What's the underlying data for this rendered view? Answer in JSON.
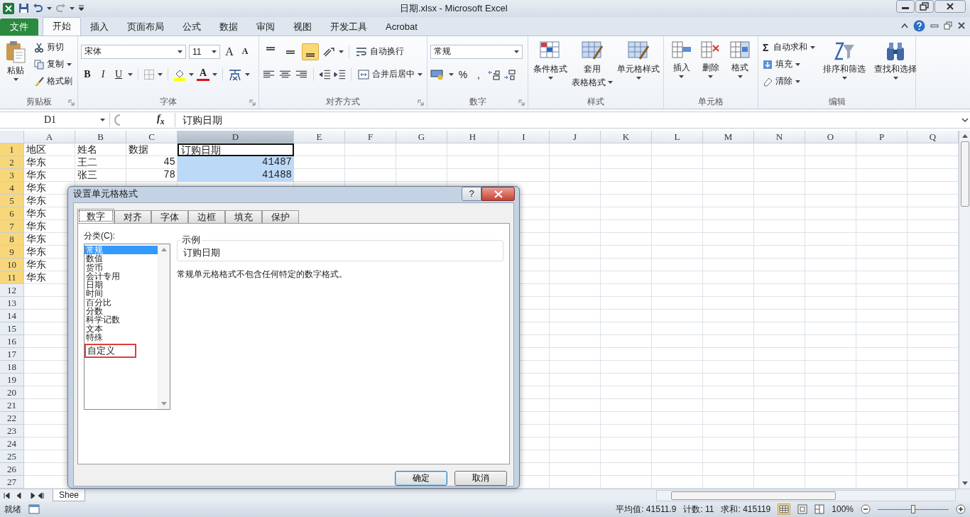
{
  "window": {
    "title": "日期.xlsx - Microsoft Excel"
  },
  "ribbon": {
    "tabs": [
      {
        "label": "文件",
        "kind": "file",
        "selected": false
      },
      {
        "label": "开始",
        "kind": "tab",
        "selected": true
      },
      {
        "label": "插入",
        "kind": "tab",
        "selected": false
      },
      {
        "label": "页面布局",
        "kind": "tab",
        "selected": false
      },
      {
        "label": "公式",
        "kind": "tab",
        "selected": false
      },
      {
        "label": "数据",
        "kind": "tab",
        "selected": false
      },
      {
        "label": "审阅",
        "kind": "tab",
        "selected": false
      },
      {
        "label": "视图",
        "kind": "tab",
        "selected": false
      },
      {
        "label": "开发工具",
        "kind": "tab",
        "selected": false
      },
      {
        "label": "Acrobat",
        "kind": "tab",
        "selected": false
      }
    ],
    "clipboard": {
      "title": "剪贴板",
      "paste": "粘贴",
      "cut": "剪切",
      "copy": "复制",
      "format_painter": "格式刷"
    },
    "font": {
      "title": "字体",
      "font_name": "宋体",
      "font_size": "11",
      "grow": "A",
      "shrink": "A",
      "bold": "B",
      "italic": "I",
      "underline": "U",
      "font_color": "A"
    },
    "alignment": {
      "title": "对齐方式",
      "vertical_align": [
        {
          "selected": false
        },
        {
          "selected": false
        },
        {
          "selected": true
        }
      ],
      "wrap": "自动换行",
      "merge": "合并后居中"
    },
    "number": {
      "title": "数字",
      "format": "常规",
      "percent": "%",
      "comma": ","
    },
    "styles": {
      "title": "样式",
      "buttons": [
        {
          "label": "条件格式",
          "kind": "conditional"
        },
        {
          "label": "套用",
          "label2": "表格格式",
          "kind": "table"
        },
        {
          "label": "单元格样式",
          "kind": "cellstyle"
        }
      ]
    },
    "cells": {
      "title": "单元格",
      "buttons": [
        {
          "label": "插入",
          "kind": "insert"
        },
        {
          "label": "删除",
          "kind": "delete"
        },
        {
          "label": "格式",
          "kind": "format"
        }
      ]
    },
    "editing": {
      "title": "编辑",
      "sigma": "Σ",
      "autosum": "自动求和",
      "fill": "填充",
      "clear": "清除",
      "sort": "排序和筛选",
      "find": "查找和选择"
    }
  },
  "formula_bar": {
    "name_box": "D1",
    "fx": "f$_{x}$",
    "content": "订购日期"
  },
  "sheet": {
    "columns": [
      {
        "label": "A",
        "selected": false
      },
      {
        "label": "B",
        "selected": false
      },
      {
        "label": "C",
        "selected": false
      },
      {
        "label": "D",
        "selected": true
      },
      {
        "label": "E",
        "selected": false
      },
      {
        "label": "F",
        "selected": false
      },
      {
        "label": "G",
        "selected": false
      },
      {
        "label": "H",
        "selected": false
      },
      {
        "label": "I",
        "selected": false
      },
      {
        "label": "J",
        "selected": false
      },
      {
        "label": "K",
        "selected": false
      },
      {
        "label": "L",
        "selected": false
      },
      {
        "label": "M",
        "selected": false
      },
      {
        "label": "N",
        "selected": false
      },
      {
        "label": "O",
        "selected": false
      },
      {
        "label": "P",
        "selected": false
      },
      {
        "label": "Q",
        "selected": false
      }
    ],
    "rows": [
      {
        "number": "1",
        "selected": true,
        "cells": [
          {
            "text": "地区",
            "kind": "text"
          },
          {
            "text": "姓名",
            "kind": "text"
          },
          {
            "text": "数据",
            "kind": "text"
          },
          {
            "text": "订购日期",
            "kind": "text",
            "active": true
          }
        ]
      },
      {
        "number": "2",
        "selected": true,
        "cells": [
          {
            "text": "华东",
            "kind": "text"
          },
          {
            "text": "王二",
            "kind": "text"
          },
          {
            "text": "45",
            "kind": "number"
          },
          {
            "text": "41487",
            "kind": "number",
            "selected": true
          }
        ]
      },
      {
        "number": "3",
        "selected": true,
        "cells": [
          {
            "text": "华东",
            "kind": "text"
          },
          {
            "text": "张三",
            "kind": "text"
          },
          {
            "text": "78",
            "kind": "number"
          },
          {
            "text": "41488",
            "kind": "number",
            "selected": true
          }
        ]
      },
      {
        "number": "4",
        "selected": true,
        "cells": [
          {
            "text": "华东",
            "kind": "text"
          }
        ]
      },
      {
        "number": "5",
        "selected": true,
        "cells": [
          {
            "text": "华东",
            "kind": "text"
          }
        ]
      },
      {
        "number": "6",
        "selected": true,
        "cells": [
          {
            "text": "华东",
            "kind": "text"
          }
        ]
      },
      {
        "number": "7",
        "selected": true,
        "cells": [
          {
            "text": "华东",
            "kind": "text"
          }
        ]
      },
      {
        "number": "8",
        "selected": true,
        "cells": [
          {
            "text": "华东",
            "kind": "text"
          }
        ]
      },
      {
        "number": "9",
        "selected": true,
        "cells": [
          {
            "text": "华东",
            "kind": "text"
          }
        ]
      },
      {
        "number": "10",
        "selected": true,
        "cells": [
          {
            "text": "华东",
            "kind": "text"
          }
        ]
      },
      {
        "number": "11",
        "selected": true,
        "cells": [
          {
            "text": "华东",
            "kind": "text"
          }
        ]
      },
      {
        "number": "12",
        "selected": false,
        "cells": []
      },
      {
        "number": "13",
        "selected": false,
        "cells": []
      },
      {
        "number": "14",
        "selected": false,
        "cells": []
      },
      {
        "number": "15",
        "selected": false,
        "cells": []
      },
      {
        "number": "16",
        "selected": false,
        "cells": []
      },
      {
        "number": "17",
        "selected": false,
        "cells": []
      },
      {
        "number": "18",
        "selected": false,
        "cells": []
      },
      {
        "number": "19",
        "selected": false,
        "cells": []
      },
      {
        "number": "20",
        "selected": false,
        "cells": []
      },
      {
        "number": "21",
        "selected": false,
        "cells": []
      },
      {
        "number": "22",
        "selected": false,
        "cells": []
      },
      {
        "number": "23",
        "selected": false,
        "cells": []
      },
      {
        "number": "24",
        "selected": false,
        "cells": []
      },
      {
        "number": "25",
        "selected": false,
        "cells": []
      },
      {
        "number": "26",
        "selected": false,
        "cells": []
      },
      {
        "number": "27",
        "selected": false,
        "cells": []
      }
    ]
  },
  "sheet_tabs": [
    {
      "label": "Shee",
      "selected": true
    }
  ],
  "dialog": {
    "title": "设置单元格格式",
    "help": "?",
    "tabs": [
      {
        "label": "数字",
        "selected": true
      },
      {
        "label": "对齐",
        "selected": false
      },
      {
        "label": "字体",
        "selected": false
      },
      {
        "label": "边框",
        "selected": false
      },
      {
        "label": "填充",
        "selected": false
      },
      {
        "label": "保护",
        "selected": false
      }
    ],
    "category_label": "分类(C):",
    "categories": [
      {
        "label": "常规",
        "selected": true,
        "marked": false
      },
      {
        "label": "数值",
        "selected": false,
        "marked": false
      },
      {
        "label": "货币",
        "selected": false,
        "marked": false
      },
      {
        "label": "会计专用",
        "selected": false,
        "marked": false
      },
      {
        "label": "日期",
        "selected": false,
        "marked": false
      },
      {
        "label": "时间",
        "selected": false,
        "marked": false
      },
      {
        "label": "百分比",
        "selected": false,
        "marked": false
      },
      {
        "label": "分数",
        "selected": false,
        "marked": false
      },
      {
        "label": "科学记数",
        "selected": false,
        "marked": false
      },
      {
        "label": "文本",
        "selected": false,
        "marked": false
      },
      {
        "label": "特殊",
        "selected": false,
        "marked": false
      },
      {
        "label": "自定义",
        "selected": false,
        "marked": true
      }
    ],
    "sample_label": "示例",
    "sample_value": "订购日期",
    "description": "常规单元格格式不包含任何特定的数字格式。",
    "buttons": [
      {
        "label": "确定",
        "kind": "default"
      },
      {
        "label": "取消",
        "kind": "normal"
      }
    ]
  },
  "status_bar": {
    "ready": "就绪",
    "average": "平均值: 41511.9",
    "count": "计数: 11",
    "sum": "求和: 415119",
    "zoom": "100%",
    "zoom_slider": {
      "level": 0.5
    }
  }
}
